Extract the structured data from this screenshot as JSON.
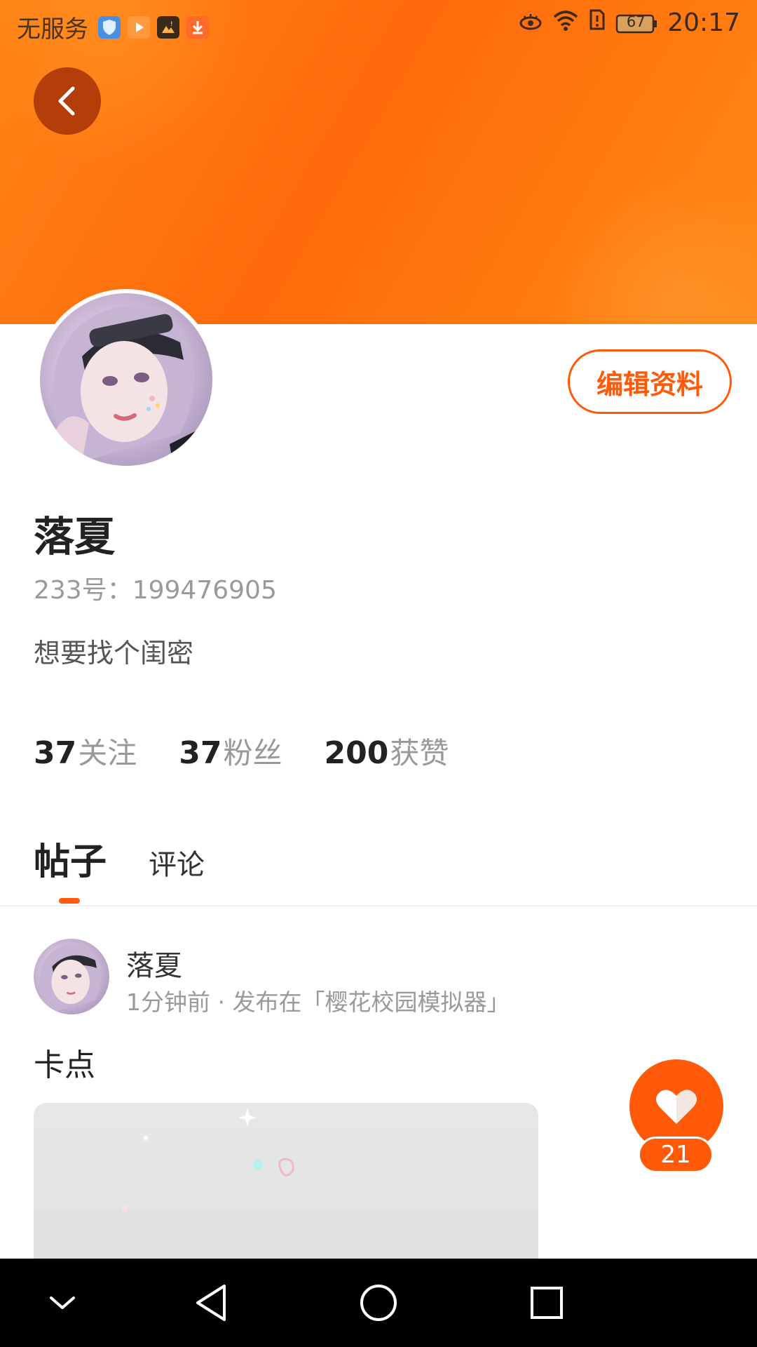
{
  "status_bar": {
    "carrier": "无服务",
    "battery": "67",
    "time": "20:17"
  },
  "profile": {
    "name": "落夏",
    "id_label": "233号：199476905",
    "bio": "想要找个闺密",
    "edit_label": "编辑资料"
  },
  "stats": [
    {
      "num": "37",
      "label": "关注"
    },
    {
      "num": "37",
      "label": "粉丝"
    },
    {
      "num": "200",
      "label": "获赞"
    }
  ],
  "tabs": {
    "active": "帖子",
    "other": "评论"
  },
  "post": {
    "author": "落夏",
    "meta": "1分钟前 · 发布在「樱花校园模拟器」",
    "text": "卡点",
    "likes": "21"
  },
  "colors": {
    "accent": "#ff5a0a",
    "banner": "#ff7a10"
  }
}
